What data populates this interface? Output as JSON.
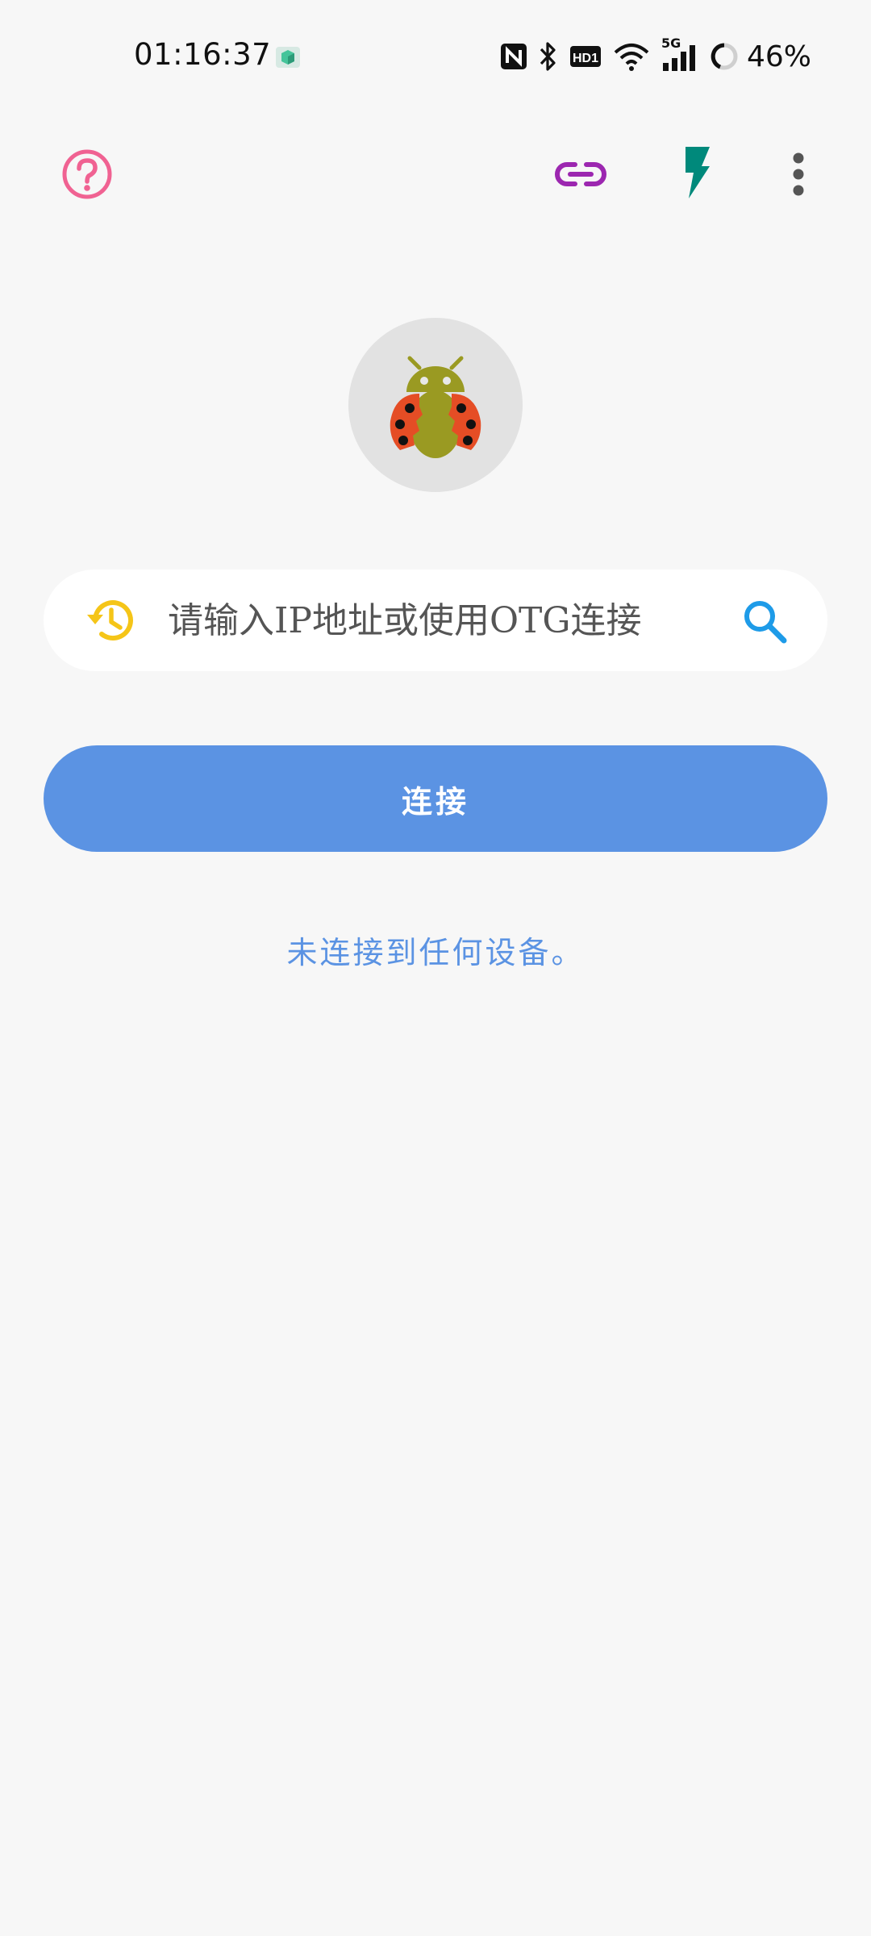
{
  "status_bar": {
    "time": "01:16:37",
    "network_type": "5G",
    "hd_label": "HD1",
    "battery": "46%"
  },
  "toolbar": {
    "help_icon": "help-circle-icon",
    "link_icon": "link-icon",
    "flash_icon": "flash-icon",
    "more_icon": "more-vert-icon"
  },
  "colors": {
    "help": "#f06292",
    "link": "#9c27b0",
    "flash": "#00897b",
    "accent": "#5b93e3",
    "history": "#f5c518",
    "search": "#1e9be8"
  },
  "search": {
    "placeholder": "请输入IP地址或使用OTG连接"
  },
  "connect_button": {
    "label": "连接"
  },
  "status_message": "未连接到任何设备。"
}
